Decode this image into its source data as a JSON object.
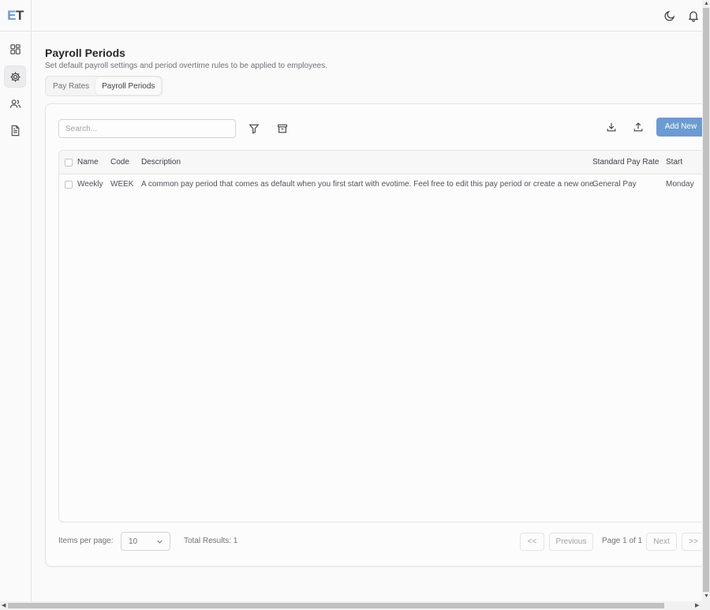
{
  "app": {
    "logo_e": "E",
    "logo_t": "T"
  },
  "sidebar": {
    "items": [
      {
        "name": "dashboard",
        "icon": "dashboard-icon"
      },
      {
        "name": "settings",
        "icon": "gear-icon",
        "active": true
      },
      {
        "name": "users",
        "icon": "users-icon"
      },
      {
        "name": "documents",
        "icon": "document-icon"
      }
    ]
  },
  "topbar": {
    "icons": [
      "moon-icon",
      "bell-icon"
    ]
  },
  "page": {
    "title": "Payroll Periods",
    "subtitle": "Set default payroll settings and period overtime rules to be applied to employees."
  },
  "tabs": [
    {
      "label": "Pay Rates",
      "active": false
    },
    {
      "label": "Payroll Periods",
      "active": true
    }
  ],
  "toolbar": {
    "search_placeholder": "Search...",
    "add_label": "Add New",
    "icons": [
      "filter-icon",
      "archive-icon",
      "download-icon",
      "upload-icon"
    ]
  },
  "table": {
    "columns": [
      "Name",
      "Code",
      "Description",
      "Standard Pay Rate",
      "Start"
    ],
    "rows": [
      {
        "name": "Weekly",
        "code": "WEEK",
        "description": "A common pay period that comes as default when you first start with evotime. Feel free to edit this pay period or create a new one.",
        "pay_rate": "General Pay",
        "start": "Monday"
      }
    ]
  },
  "footer": {
    "items_per_page_label": "Items per page:",
    "items_per_page_value": "10",
    "total_results": "Total Results: 1",
    "first_label": "<<",
    "previous_label": "Previous",
    "page_info": "Page 1 of 1",
    "next_label": "Next",
    "last_label": ">>"
  },
  "colors": {
    "accent": "#6c9bd2",
    "border": "#e4e4e7",
    "text": "#27272a",
    "muted": "#71717a"
  }
}
